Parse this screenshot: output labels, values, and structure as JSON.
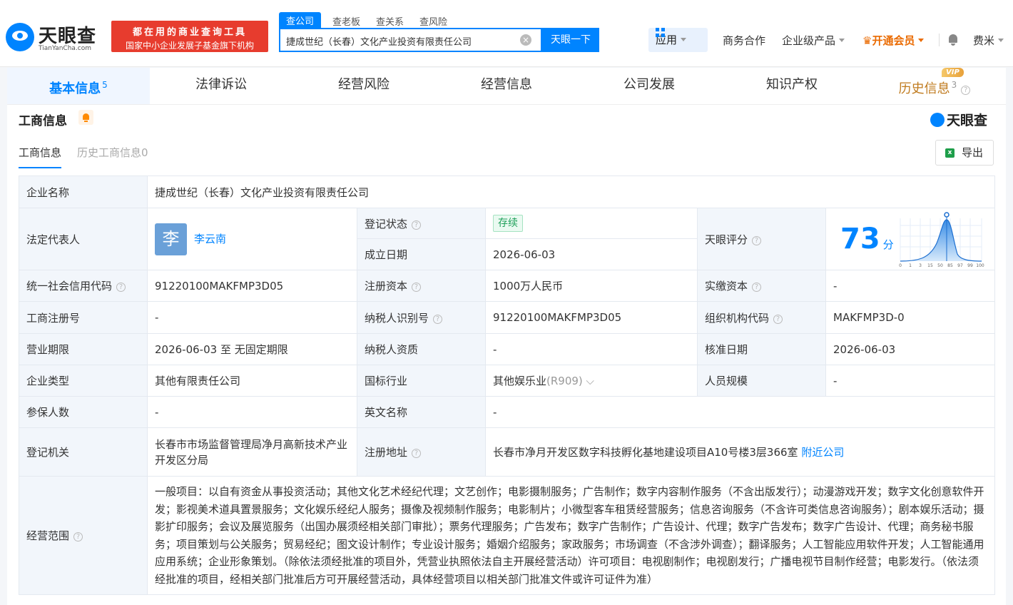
{
  "header": {
    "logo_text": "天眼查",
    "logo_sub": "TianYanCha.com",
    "slogan_line1": "都在用的商业查询工具",
    "slogan_line2": "国家中小企业发展子基金旗下机构",
    "search_tabs": [
      "查公司",
      "查老板",
      "查关系",
      "查风险"
    ],
    "search_value": "捷成世纪（长春）文化产业投资有限责任公司",
    "search_button": "天眼一下",
    "nav_app": "应用",
    "nav_business": "商务合作",
    "nav_enterprise": "企业级产品",
    "nav_vip": "开通会员",
    "nav_user": "费米"
  },
  "main_tabs": [
    {
      "label": "基本信息",
      "count": "5"
    },
    {
      "label": "法律诉讼",
      "count": ""
    },
    {
      "label": "经营风险",
      "count": ""
    },
    {
      "label": "经营信息",
      "count": ""
    },
    {
      "label": "公司发展",
      "count": ""
    },
    {
      "label": "知识产权",
      "count": ""
    },
    {
      "label": "历史信息",
      "count": "3"
    }
  ],
  "vip_badge": "VIP",
  "section": {
    "title": "工商信息",
    "watermark": "天眼查",
    "subtabs": [
      "工商信息",
      "历史工商信息0"
    ],
    "export": "导出"
  },
  "info": {
    "company_name_k": "企业名称",
    "company_name_v": "捷成世纪（长春）文化产业投资有限责任公司",
    "legal_rep_k": "法定代表人",
    "legal_rep_avatar": "李",
    "legal_rep_v": "李云南",
    "reg_status_k": "登记状态",
    "reg_status_v": "存续",
    "est_date_k": "成立日期",
    "est_date_v": "2026-06-03",
    "score_k": "天眼评分",
    "score_v": "73",
    "score_unit": "分",
    "score_ticks": [
      "0",
      "1",
      "3",
      "15",
      "50",
      "85",
      "97",
      "99",
      "100"
    ],
    "credit_code_k": "统一社会信用代码",
    "credit_code_v": "91220100MAKFMP3D05",
    "reg_capital_k": "注册资本",
    "reg_capital_v": "1000万人民币",
    "paid_capital_k": "实缴资本",
    "paid_capital_v": "-",
    "reg_no_k": "工商注册号",
    "reg_no_v": "-",
    "tax_id_k": "纳税人识别号",
    "tax_id_v": "91220100MAKFMP3D05",
    "org_code_k": "组织机构代码",
    "org_code_v": "MAKFMP3D-0",
    "term_k": "营业期限",
    "term_v": "2026-06-03 至 无固定期限",
    "tax_qual_k": "纳税人资质",
    "tax_qual_v": "-",
    "approve_date_k": "核准日期",
    "approve_date_v": "2026-06-03",
    "type_k": "企业类型",
    "type_v": "其他有限责任公司",
    "industry_k": "国标行业",
    "industry_v": "其他娱乐业",
    "industry_code": "(R909)",
    "staff_k": "人员规模",
    "staff_v": "-",
    "insured_k": "参保人数",
    "insured_v": "-",
    "en_name_k": "英文名称",
    "en_name_v": "-",
    "authority_k": "登记机关",
    "authority_v": "长春市市场监督管理局净月高新技术产业开发区分局",
    "address_k": "注册地址",
    "address_v": "长春市净月开发区数字科技孵化基地建设项目A10号楼3层366室",
    "nearby": "附近公司",
    "scope_k": "经营范围",
    "scope_v": "一般项目：以自有资金从事投资活动；其他文化艺术经纪代理；文艺创作；电影摄制服务；广告制作；数字内容制作服务（不含出版发行）；动漫游戏开发；数字文化创意软件开发；影视美术道具置景服务；文化娱乐经纪人服务；摄像及视频制作服务；电影制片；小微型客车租赁经营服务；信息咨询服务（不含许可类信息咨询服务）；剧本娱乐活动；摄影扩印服务；会议及展览服务（出国办展须经相关部门审批）；票务代理服务；广告发布；数字广告制作；广告设计、代理；数字广告发布；数字广告设计、代理；商务秘书服务；项目策划与公关服务；贸易经纪；图文设计制作；专业设计服务；婚姻介绍服务；家政服务；市场调查（不含涉外调查）；翻译服务；人工智能应用软件开发；人工智能通用应用系统；企业形象策划。（除依法须经批准的项目外，凭营业执照依法自主开展经营活动）许可项目：电视剧制作；电视剧发行；广播电视节目制作经营；电影发行。（依法须经批准的项目，经相关部门批准后方可开展经营活动，具体经营项目以相关部门批准文件或许可证件为准）"
  }
}
